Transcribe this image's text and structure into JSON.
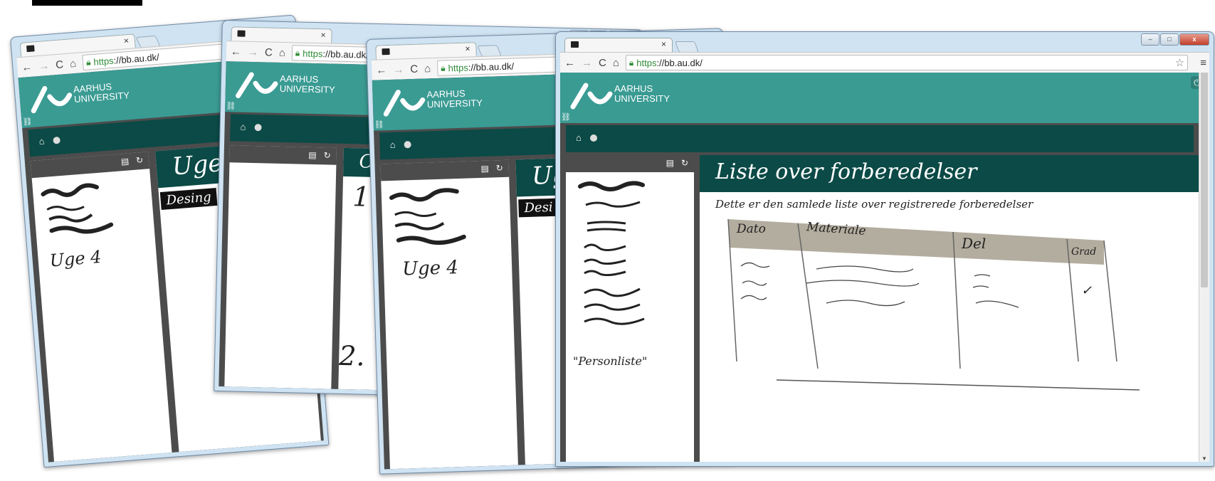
{
  "browser": {
    "tab_close": "×",
    "url_https": "https",
    "url_rest": "://bb.au.dk/",
    "back": "←",
    "forward": "→",
    "reload": "C",
    "home": "⌂",
    "star": "☆",
    "menu": "≡",
    "win_min": "‒",
    "win_max": "□",
    "win_close": "x"
  },
  "brand": {
    "line1": "AARHUS",
    "line2": "UNIVERSITY"
  },
  "windows": {
    "w1": {
      "sidebar_caption": "Uge 4",
      "content_title": "Uge",
      "content_sub": "Desing"
    },
    "w2": {
      "content_title": "O",
      "step1": "1.",
      "step2": "2."
    },
    "w3": {
      "sidebar_caption": "Uge 4",
      "content_title": "Ug",
      "content_sub": "Desi"
    },
    "w4": {
      "title": "Liste over forberedelser",
      "description": "Dette er den samlede liste over registrerede forberedelser",
      "sidebar_caption": "\"Personliste\"",
      "columns": [
        "Dato",
        "Materiale",
        "Del",
        "Grad"
      ],
      "check": "✓"
    }
  },
  "colors": {
    "teal": "#3a9b93",
    "dark_teal": "#0b4a46",
    "gray": "#4c4c4c",
    "header_beige": "#b3ad9f"
  },
  "icons": [
    "back-icon",
    "forward-icon",
    "reload-icon",
    "home-icon",
    "lock-icon",
    "star-icon",
    "menu-icon",
    "power-icon",
    "folder-icon",
    "refresh-icon",
    "link-icon"
  ]
}
